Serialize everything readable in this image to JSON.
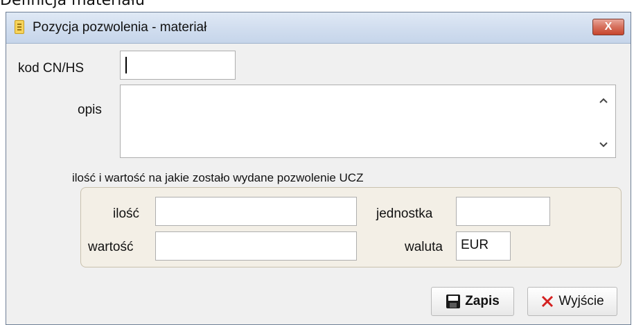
{
  "background": {
    "title_fragment": "Definicja materiału"
  },
  "window": {
    "title": "Pozycja pozwolenia - materiał",
    "close_glyph": "X",
    "icons": {
      "app": "notepad-icon",
      "close": "close-icon"
    }
  },
  "form": {
    "kod_label": "kod CN/HS",
    "kod_value": "",
    "opis_label": "opis",
    "opis_value": "",
    "section_label": "ilość  i wartość na jakie zostało wydane pozwolenie UCZ",
    "ilosc_label": "ilość",
    "ilosc_value": "",
    "jednostka_label": "jednostka",
    "jednostka_value": "",
    "wartosc_label": "wartość",
    "wartosc_value": "",
    "waluta_label": "waluta",
    "waluta_value": "EUR"
  },
  "buttons": {
    "save_label": "Zapis",
    "exit_label": "Wyjście",
    "save_icon": "floppy-disk-icon",
    "exit_icon": "red-x-icon"
  },
  "colors": {
    "titlebar": "#cfdcee",
    "close_button": "#d6705c",
    "groupbox": "#f3efe6",
    "exit_icon": "#d42020"
  }
}
